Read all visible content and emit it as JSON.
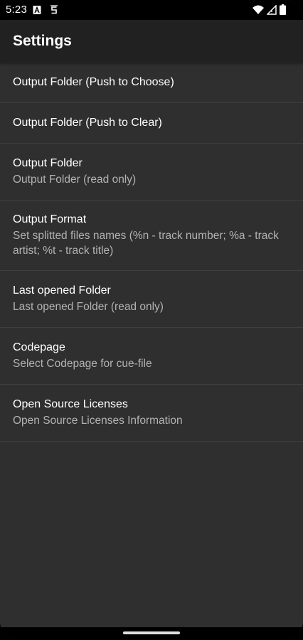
{
  "status_bar": {
    "time": "5:23",
    "notification_icons": [
      "a-box-notification-icon",
      "s-notification-icon"
    ],
    "system_icons": [
      "wifi-icon",
      "signal-icon",
      "battery-icon"
    ]
  },
  "app_bar": {
    "title": "Settings"
  },
  "settings": {
    "items": [
      {
        "title": "Output Folder (Push to Choose)",
        "summary": ""
      },
      {
        "title": "Output Folder (Push to Clear)",
        "summary": ""
      },
      {
        "title": "Output Folder",
        "summary": "Output Folder (read only)"
      },
      {
        "title": "Output Format",
        "summary": "Set splitted files names (%n - track number; %a - track artist; %t - track title)"
      },
      {
        "title": "Last opened Folder",
        "summary": "Last opened Folder (read only)"
      },
      {
        "title": "Codepage",
        "summary": "Select Codepage for cue-file"
      },
      {
        "title": "Open Source Licenses",
        "summary": "Open Source Licenses Information"
      }
    ]
  },
  "colors": {
    "background": "#2f2f2f",
    "app_bar": "#212121",
    "divider": "#3f3f3f",
    "title_text": "#ffffff",
    "summary_text": "#b3b3b3"
  }
}
